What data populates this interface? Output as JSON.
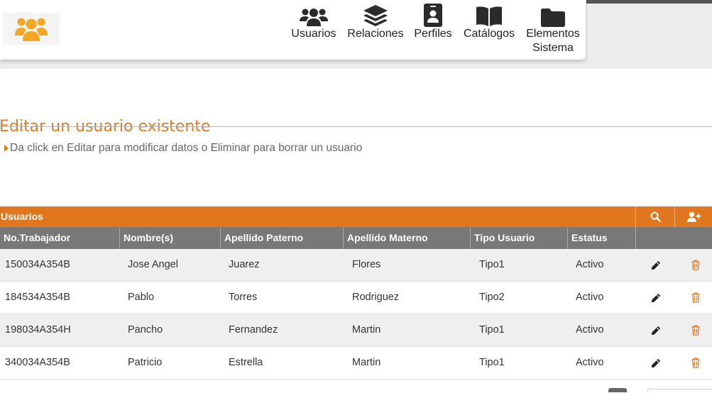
{
  "nav": {
    "items": [
      {
        "label": "Usuarios",
        "icon": "users-icon"
      },
      {
        "label": "Relaciones",
        "icon": "layers-icon"
      },
      {
        "label": "Perfiles",
        "icon": "id-badge-icon"
      },
      {
        "label": "Catálogos",
        "icon": "book-icon"
      },
      {
        "label": "Elementos\nSistema",
        "icon": "folder-icon"
      }
    ]
  },
  "page": {
    "heading": "Editar un usuario existente",
    "hint": "Da click en Editar para modificar datos o Eliminar para borrar un usuario"
  },
  "table": {
    "title": "Usuarios",
    "columns": [
      "No.Trabajador",
      "Nombre(s)",
      "Apellido Paterno",
      "Apellido Materno",
      "Tipo Usuario",
      "Estatus"
    ],
    "rows": [
      [
        "150034A354B",
        "Jose Angel",
        "Juarez",
        "Flores",
        "Tipo1",
        "Activo"
      ],
      [
        "184534A354B",
        "Pablo",
        "Torres",
        "Rodriguez",
        "Tipo2",
        "Activo"
      ],
      [
        "198034A354H",
        "Pancho",
        "Fernandez",
        "Martin",
        "Tipo1",
        "Activo"
      ],
      [
        "340034A354B",
        "Patricio",
        "Estrella",
        "Martin",
        "Tipo1",
        "Activo"
      ]
    ]
  },
  "colors": {
    "accent": "#e0761d",
    "heading": "#e07a1f",
    "header_gray": "#787878",
    "logo": "#f5a623"
  }
}
